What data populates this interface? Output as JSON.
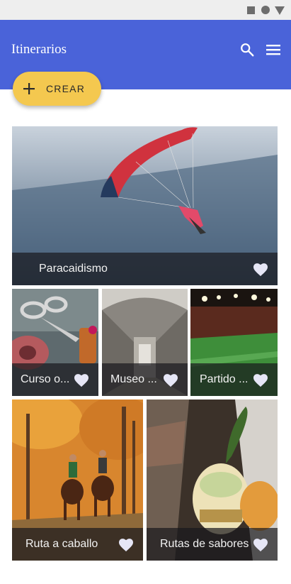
{
  "app_bar": {
    "title": "Itinerarios",
    "icons": [
      "search-icon",
      "menu-icon"
    ],
    "color": "#4a63d9"
  },
  "create_button": {
    "label": "CREAR",
    "icon": "plus-icon",
    "color": "#f4c84f"
  },
  "itineraries": [
    {
      "title": "Paracaidismo",
      "favorite_icon": "heart-icon"
    },
    {
      "title": "Curso o...",
      "favorite_icon": "heart-icon"
    },
    {
      "title": "Museo ...",
      "favorite_icon": "heart-icon"
    },
    {
      "title": "Partido ...",
      "favorite_icon": "heart-icon"
    },
    {
      "title": "Ruta a caballo",
      "favorite_icon": "heart-icon"
    },
    {
      "title": "Rutas de sabores",
      "favorite_icon": "heart-icon"
    }
  ],
  "heart_color": "#e6e6f6"
}
